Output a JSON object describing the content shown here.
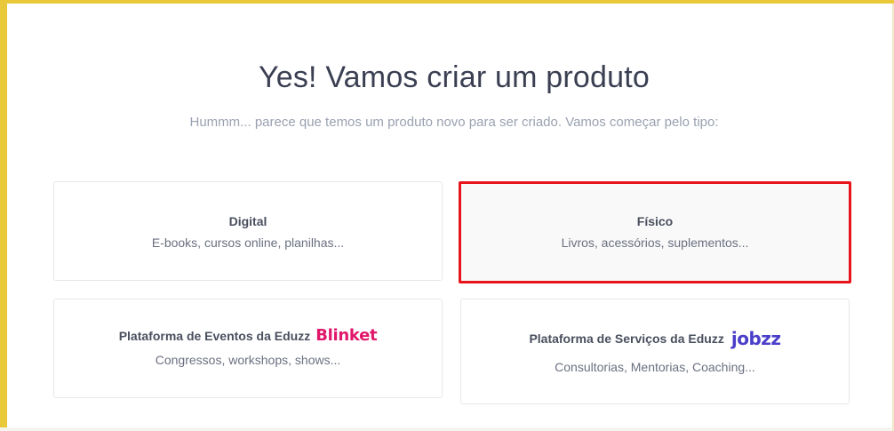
{
  "header": {
    "title": "Yes! Vamos criar um produto",
    "subtitle": "Hummm... parece que temos um produto novo para ser criado. Vamos começar pelo tipo:"
  },
  "product_types": [
    {
      "title": "Digital",
      "description": "E-books, cursos online, planilhas..."
    },
    {
      "title": "Físico",
      "description": "Livros, acessórios, suplementos...",
      "selected": true
    },
    {
      "title": "Plataforma de Eventos da Eduzz",
      "brand": "Blinket",
      "brand_color": "#e0176a",
      "description": "Congressos, workshops, shows..."
    },
    {
      "title": "Plataforma de Serviços da Eduzz",
      "brand": "jobzz",
      "brand_color": "#4b3fc9",
      "description": "Consultorias, Mentorias, Coaching..."
    }
  ],
  "colors": {
    "frame": "#e9c93a",
    "selection_outline": "#e8141c"
  }
}
